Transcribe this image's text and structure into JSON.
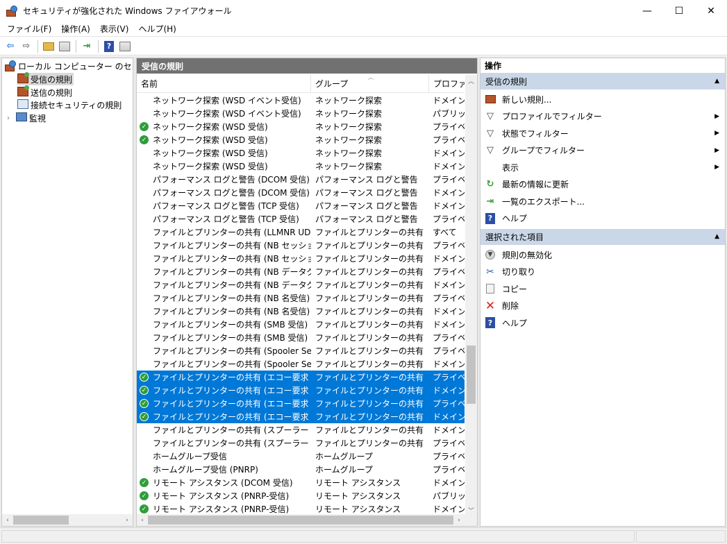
{
  "window": {
    "title": "セキュリティが強化された Windows ファイアウォール",
    "minimize": "—",
    "maximize": "☐",
    "close": "✕"
  },
  "menu": [
    "ファイル(F)",
    "操作(A)",
    "表示(V)",
    "ヘルプ(H)"
  ],
  "toolbar": {
    "icons": [
      "back-arrow-icon",
      "forward-arrow-icon",
      "up-folder-icon",
      "show-hide-tree-icon",
      "export-list-icon",
      "help-icon",
      "show-hide-action-pane-icon"
    ]
  },
  "tree": {
    "root": "ローカル コンピューター のセキュリティ",
    "items": [
      "受信の規則",
      "送信の規則",
      "接続セキュリティの規則",
      "監視"
    ],
    "selected": "受信の規則"
  },
  "center": {
    "header": "受信の規則",
    "columns": [
      "名前",
      "グループ",
      "プロファイル"
    ],
    "rows": [
      {
        "enabled": false,
        "selected": false,
        "name": "ネットワーク探索 (WSD イベント受信)",
        "group": "ネットワーク探索",
        "profile": "ドメイン"
      },
      {
        "enabled": false,
        "selected": false,
        "name": "ネットワーク探索 (WSD イベント受信)",
        "group": "ネットワーク探索",
        "profile": "パブリック"
      },
      {
        "enabled": true,
        "selected": false,
        "name": "ネットワーク探索 (WSD 受信)",
        "group": "ネットワーク探索",
        "profile": "プライベー"
      },
      {
        "enabled": true,
        "selected": false,
        "name": "ネットワーク探索 (WSD 受信)",
        "group": "ネットワーク探索",
        "profile": "プライベー"
      },
      {
        "enabled": false,
        "selected": false,
        "name": "ネットワーク探索 (WSD 受信)",
        "group": "ネットワーク探索",
        "profile": "ドメイン, /"
      },
      {
        "enabled": false,
        "selected": false,
        "name": "ネットワーク探索 (WSD 受信)",
        "group": "ネットワーク探索",
        "profile": "ドメイン, /"
      },
      {
        "enabled": false,
        "selected": false,
        "name": "パフォーマンス ログと警告 (DCOM 受信)",
        "group": "パフォーマンス ログと警告",
        "profile": "プライベー"
      },
      {
        "enabled": false,
        "selected": false,
        "name": "パフォーマンス ログと警告 (DCOM 受信)",
        "group": "パフォーマンス ログと警告",
        "profile": "ドメイン"
      },
      {
        "enabled": false,
        "selected": false,
        "name": "パフォーマンス ログと警告 (TCP 受信)",
        "group": "パフォーマンス ログと警告",
        "profile": "ドメイン"
      },
      {
        "enabled": false,
        "selected": false,
        "name": "パフォーマンス ログと警告 (TCP 受信)",
        "group": "パフォーマンス ログと警告",
        "profile": "プライベー"
      },
      {
        "enabled": false,
        "selected": false,
        "name": "ファイルとプリンターの共有 (LLMNR UDP 受信)",
        "group": "ファイルとプリンターの共有",
        "profile": "すべて"
      },
      {
        "enabled": false,
        "selected": false,
        "name": "ファイルとプリンターの共有 (NB セッション受信)",
        "group": "ファイルとプリンターの共有",
        "profile": "プライベー"
      },
      {
        "enabled": false,
        "selected": false,
        "name": "ファイルとプリンターの共有 (NB セッション受信)",
        "group": "ファイルとプリンターの共有",
        "profile": "ドメイン"
      },
      {
        "enabled": false,
        "selected": false,
        "name": "ファイルとプリンターの共有 (NB データグラム受信)",
        "group": "ファイルとプリンターの共有",
        "profile": "プライベー"
      },
      {
        "enabled": false,
        "selected": false,
        "name": "ファイルとプリンターの共有 (NB データグラム受信)",
        "group": "ファイルとプリンターの共有",
        "profile": "ドメイン"
      },
      {
        "enabled": false,
        "selected": false,
        "name": "ファイルとプリンターの共有 (NB 名受信)",
        "group": "ファイルとプリンターの共有",
        "profile": "プライベー"
      },
      {
        "enabled": false,
        "selected": false,
        "name": "ファイルとプリンターの共有 (NB 名受信)",
        "group": "ファイルとプリンターの共有",
        "profile": "ドメイン"
      },
      {
        "enabled": false,
        "selected": false,
        "name": "ファイルとプリンターの共有 (SMB 受信)",
        "group": "ファイルとプリンターの共有",
        "profile": "ドメイン"
      },
      {
        "enabled": false,
        "selected": false,
        "name": "ファイルとプリンターの共有 (SMB 受信)",
        "group": "ファイルとプリンターの共有",
        "profile": "プライベー"
      },
      {
        "enabled": false,
        "selected": false,
        "name": "ファイルとプリンターの共有 (Spooler Service - ...",
        "group": "ファイルとプリンターの共有",
        "profile": "プライベー"
      },
      {
        "enabled": false,
        "selected": false,
        "name": "ファイルとプリンターの共有 (Spooler Service - ...",
        "group": "ファイルとプリンターの共有",
        "profile": "ドメイン"
      },
      {
        "enabled": true,
        "selected": true,
        "name": "ファイルとプリンターの共有 (エコー要求 - ICMP...",
        "group": "ファイルとプリンターの共有",
        "profile": "プライベー"
      },
      {
        "enabled": true,
        "selected": true,
        "name": "ファイルとプリンターの共有 (エコー要求 - ICMP...",
        "group": "ファイルとプリンターの共有",
        "profile": "ドメイン"
      },
      {
        "enabled": true,
        "selected": true,
        "name": "ファイルとプリンターの共有 (エコー要求 - ICMP...",
        "group": "ファイルとプリンターの共有",
        "profile": "プライベー"
      },
      {
        "enabled": true,
        "selected": true,
        "name": "ファイルとプリンターの共有 (エコー要求 - ICMP...",
        "group": "ファイルとプリンターの共有",
        "profile": "ドメイン"
      },
      {
        "enabled": false,
        "selected": false,
        "name": "ファイルとプリンターの共有 (スプーラー サービス - ...",
        "group": "ファイルとプリンターの共有",
        "profile": "ドメイン"
      },
      {
        "enabled": false,
        "selected": false,
        "name": "ファイルとプリンターの共有 (スプーラー サービス - ...",
        "group": "ファイルとプリンターの共有",
        "profile": "プライベー"
      },
      {
        "enabled": false,
        "selected": false,
        "name": "ホームグループ受信",
        "group": "ホームグループ",
        "profile": "プライベー"
      },
      {
        "enabled": false,
        "selected": false,
        "name": "ホームグループ受信 (PNRP)",
        "group": "ホームグループ",
        "profile": "プライベー"
      },
      {
        "enabled": true,
        "selected": false,
        "name": "リモート アシスタンス (DCOM 受信)",
        "group": "リモート アシスタンス",
        "profile": "ドメイン"
      },
      {
        "enabled": true,
        "selected": false,
        "name": "リモート アシスタンス (PNRP-受信)",
        "group": "リモート アシスタンス",
        "profile": "パブリック"
      },
      {
        "enabled": true,
        "selected": false,
        "name": "リモート アシスタンス (PNRP-受信)",
        "group": "リモート アシスタンス",
        "profile": "ドメイン, プ"
      }
    ]
  },
  "actions": {
    "header": "操作",
    "sections": [
      {
        "title": "受信の規則",
        "items": [
          {
            "label": "新しい規則...",
            "icon": "new-rule-icon",
            "submenu": false
          },
          {
            "label": "プロファイルでフィルター",
            "icon": "filter-icon",
            "submenu": true
          },
          {
            "label": "状態でフィルター",
            "icon": "filter-icon",
            "submenu": true
          },
          {
            "label": "グループでフィルター",
            "icon": "filter-icon",
            "submenu": true
          },
          {
            "label": "表示",
            "icon": "",
            "submenu": true
          },
          {
            "label": "最新の情報に更新",
            "icon": "refresh-icon",
            "submenu": false
          },
          {
            "label": "一覧のエクスポート...",
            "icon": "export-icon",
            "submenu": false
          },
          {
            "label": "ヘルプ",
            "icon": "help-icon",
            "submenu": false
          }
        ]
      },
      {
        "title": "選択された項目",
        "items": [
          {
            "label": "規則の無効化",
            "icon": "disable-icon",
            "submenu": false
          },
          {
            "label": "切り取り",
            "icon": "cut-icon",
            "submenu": false
          },
          {
            "label": "コピー",
            "icon": "copy-icon",
            "submenu": false
          },
          {
            "label": "削除",
            "icon": "delete-icon",
            "submenu": false
          },
          {
            "label": "ヘルプ",
            "icon": "help-icon",
            "submenu": false
          }
        ]
      }
    ]
  },
  "colors": {
    "selection": "#0078d7",
    "panel_header": "#717171",
    "section_header": "#c9d7e8",
    "enabled_check": "#2e9e3b"
  }
}
